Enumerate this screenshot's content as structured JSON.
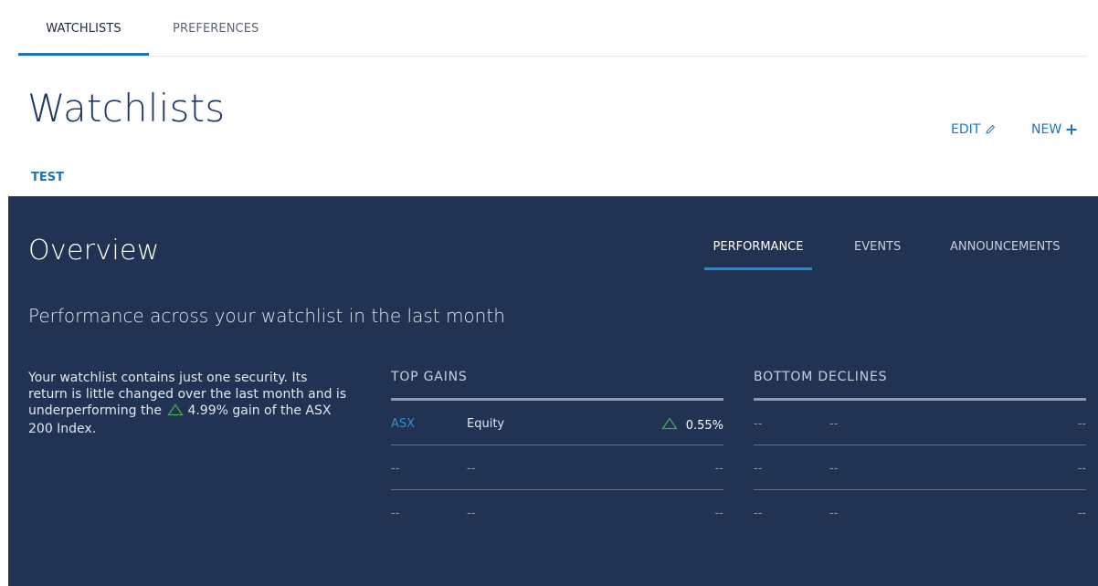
{
  "top_tabs": [
    {
      "label": "WATCHLISTS",
      "active": true
    },
    {
      "label": "PREFERENCES",
      "active": false
    }
  ],
  "header": {
    "title": "Watchlists",
    "edit_label": "EDIT",
    "new_label": "NEW"
  },
  "watchlist_tabs": [
    {
      "label": "TEST",
      "active": true
    }
  ],
  "overview": {
    "title": "Overview",
    "tabs": [
      {
        "label": "PERFORMANCE",
        "active": true
      },
      {
        "label": "EVENTS",
        "active": false
      },
      {
        "label": "ANNOUNCEMENTS",
        "active": false
      }
    ],
    "subtitle": "Performance across your watchlist in the last month",
    "summary": {
      "text_before": "Your watchlist contains just one security. Its return is little changed over the last month and is underperforming the",
      "value": "4.99%",
      "text_after": "gain of the ASX 200 Index."
    },
    "top_gains": {
      "title": "TOP GAINS",
      "rows": [
        {
          "code": "ASX",
          "type": "Equity",
          "value": "0.55%",
          "trend": "up"
        },
        {
          "code": "--",
          "type": "--",
          "value": "--",
          "trend": ""
        },
        {
          "code": "--",
          "type": "--",
          "value": "--",
          "trend": ""
        }
      ]
    },
    "bottom_declines": {
      "title": "BOTTOM DECLINES",
      "rows": [
        {
          "code": "--",
          "type": "--",
          "value": "--"
        },
        {
          "code": "--",
          "type": "--",
          "value": "--"
        },
        {
          "code": "--",
          "type": "--",
          "value": "--"
        }
      ]
    }
  },
  "colors": {
    "accent": "#1a76b8",
    "panel": "#213252",
    "gain": "#3fae49"
  },
  "icons": {
    "edit": "pencil-icon",
    "new": "plus-icon",
    "trend_up": "triangle-up-icon"
  }
}
